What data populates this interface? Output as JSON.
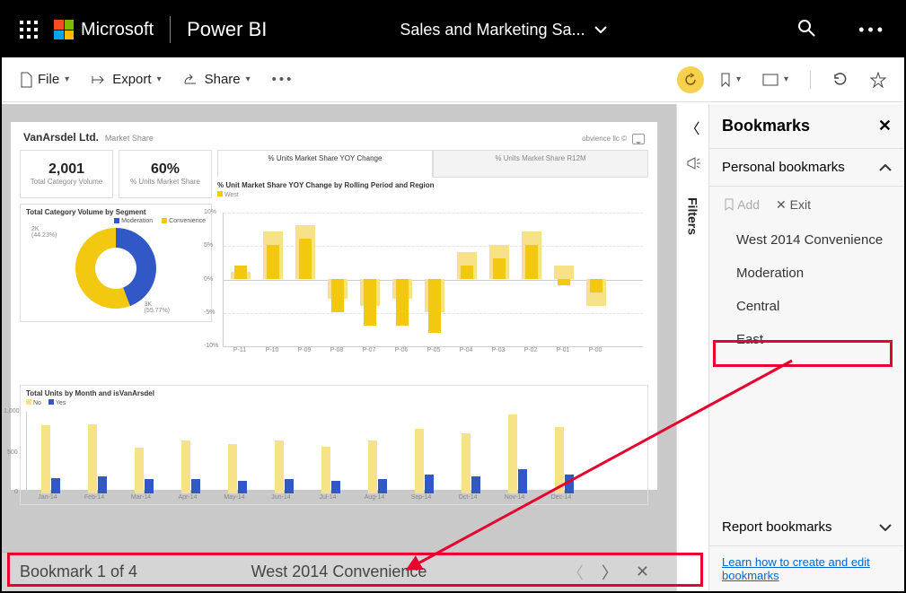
{
  "topbar": {
    "ms_label": "Microsoft",
    "brand": "Power BI",
    "report_name": "Sales and Marketing Sa..."
  },
  "toolbar": {
    "file": "File",
    "export": "Export",
    "share": "Share"
  },
  "filters_label": "Filters",
  "report": {
    "company": "VanArsdel Ltd.",
    "company_sub": "Market Share",
    "credit": "obvience llc ©",
    "kpi1_value": "2,001",
    "kpi1_label": "Total Category Volume",
    "kpi2_value": "60%",
    "kpi2_label": "% Units Market Share",
    "tab_active": "% Units Market Share YOY Change",
    "tab_inactive": "% Units Market Share R12M",
    "donut_title": "Total Category Volume by Segment",
    "donut_legend_a": "Moderation",
    "donut_legend_b": "Convenience",
    "donut_label_a": "2K\n(44.23%)",
    "donut_label_b": "3K\n(55.77%)",
    "bar_title": "% Unit Market Share YOY Change by Rolling Period and Region",
    "bar_legend": "West",
    "units_title": "Total Units by Month and isVanArsdel",
    "units_legend_no": "No",
    "units_legend_yes": "Yes"
  },
  "chart_data": [
    {
      "type": "bar",
      "title": "% Unit Market Share YOY Change by Rolling Period and Region",
      "series": [
        {
          "name": "West",
          "values": [
            2,
            5,
            6,
            -5,
            -7,
            -7,
            -8,
            2,
            3,
            5,
            -1,
            -2
          ]
        }
      ],
      "secondary_values": [
        1,
        7,
        8,
        -3,
        -4,
        -3,
        -5,
        4,
        5,
        7,
        2,
        -4
      ],
      "categories": [
        "P-11",
        "P-10",
        "P-09",
        "P-08",
        "P-07",
        "P-06",
        "P-05",
        "P-04",
        "P-03",
        "P-02",
        "P-01",
        "P-00"
      ],
      "ylabel": "%",
      "ylim": [
        -10,
        10
      ]
    },
    {
      "type": "pie",
      "title": "Total Category Volume by Segment",
      "series": [
        {
          "name": "Moderation",
          "value": 44.23
        },
        {
          "name": "Convenience",
          "value": 55.77
        }
      ],
      "labels": [
        "2K (44.23%)",
        "3K (55.77%)"
      ]
    },
    {
      "type": "bar",
      "title": "Total Units by Month and isVanArsdel",
      "categories": [
        "Jan-14",
        "Feb-14",
        "Mar-14",
        "Apr-14",
        "May-14",
        "Jun-14",
        "Jul-14",
        "Aug-14",
        "Sep-14",
        "Oct-14",
        "Nov-14",
        "Dec-14"
      ],
      "series": [
        {
          "name": "No",
          "values": [
            900,
            920,
            600,
            700,
            650,
            700,
            620,
            700,
            850,
            800,
            1050,
            880
          ]
        },
        {
          "name": "Yes",
          "values": [
            200,
            220,
            180,
            180,
            160,
            180,
            160,
            180,
            250,
            220,
            320,
            250
          ]
        }
      ],
      "ylim": [
        0,
        1000
      ]
    }
  ],
  "bookmark_bar": {
    "counter": "Bookmark 1 of 4",
    "current": "West 2014 Convenience"
  },
  "bookmarks_pane": {
    "title": "Bookmarks",
    "section_personal": "Personal bookmarks",
    "action_add": "Add",
    "action_exit": "Exit",
    "items": [
      "West 2014 Convenience",
      "Moderation",
      "Central",
      "East"
    ],
    "section_report": "Report bookmarks",
    "learn_link": "Learn how to create and edit bookmarks"
  }
}
